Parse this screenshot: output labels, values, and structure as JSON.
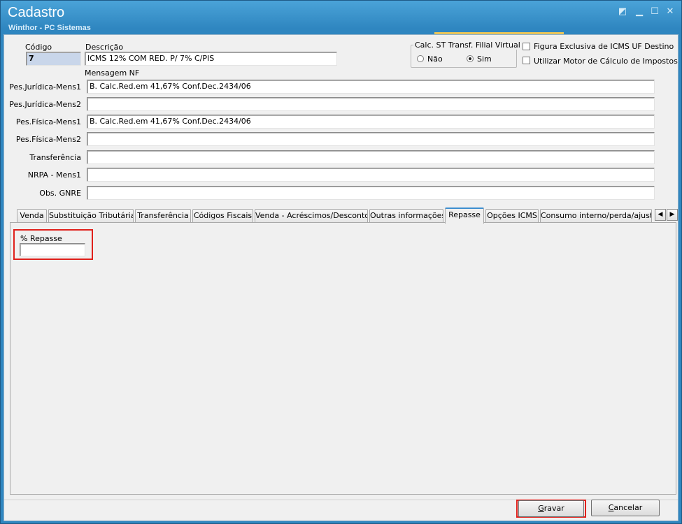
{
  "window": {
    "title": "Cadastro",
    "subtitle": "Winthor - PC Sistemas",
    "controls": [
      "◩",
      "▁",
      "☐",
      "✕"
    ]
  },
  "form": {
    "codigo_label": "Código",
    "codigo_value": "7",
    "descricao_label": "Descrição",
    "descricao_value": "ICMS 12% COM RED. P/ 7% C/PIS",
    "calc_st_group": {
      "title": "Calc. ST Transf. Filial Virtual",
      "option_nao": "Não",
      "option_sim": "Sim",
      "selected": "Sim"
    },
    "checkbox_figura": "Figura Exclusiva de ICMS UF Destino",
    "checkbox_motor": "Utilizar Motor de Cálculo de Impostos",
    "mensagem_nf_label": "Mensagem NF",
    "rows": [
      {
        "label": "Pes.Jurídica-Mens1",
        "value": "B. Calc.Red.em 41,67% Conf.Dec.2434/06"
      },
      {
        "label": "Pes.Jurídica-Mens2",
        "value": ""
      },
      {
        "label": "Pes.Física-Mens1",
        "value": "B. Calc.Red.em 41,67% Conf.Dec.2434/06"
      },
      {
        "label": "Pes.Física-Mens2",
        "value": ""
      },
      {
        "label": "Transferência",
        "value": ""
      },
      {
        "label": "NRPA - Mens1",
        "value": ""
      },
      {
        "label": "Obs. GNRE",
        "value": ""
      }
    ]
  },
  "tabs": [
    "Venda",
    "Substituição Tributária",
    "Transferência",
    "Códigos Fiscais",
    "Venda - Acréscimos/Descontos",
    "Outras informações",
    "Repasse",
    "Opções ICMS",
    "Consumo interno/perda/ajuste"
  ],
  "active_tab": "Repasse",
  "repasse": {
    "label": "% Repasse",
    "value": ""
  },
  "buttons": {
    "gravar": "Gravar",
    "gravar_accel": "G",
    "gravar_rest": "ravar",
    "cancelar": "Cancelar",
    "cancelar_accel": "C",
    "cancelar_rest": "ancelar"
  },
  "colors": {
    "title_bar": "#2f86c0",
    "highlight": "#e0201b",
    "code_field_bg": "#c9d6ea",
    "active_tab_accent": "#3e8fd0"
  },
  "icons": {
    "tab_scroll_left": "◀",
    "tab_scroll_right": "▶"
  }
}
